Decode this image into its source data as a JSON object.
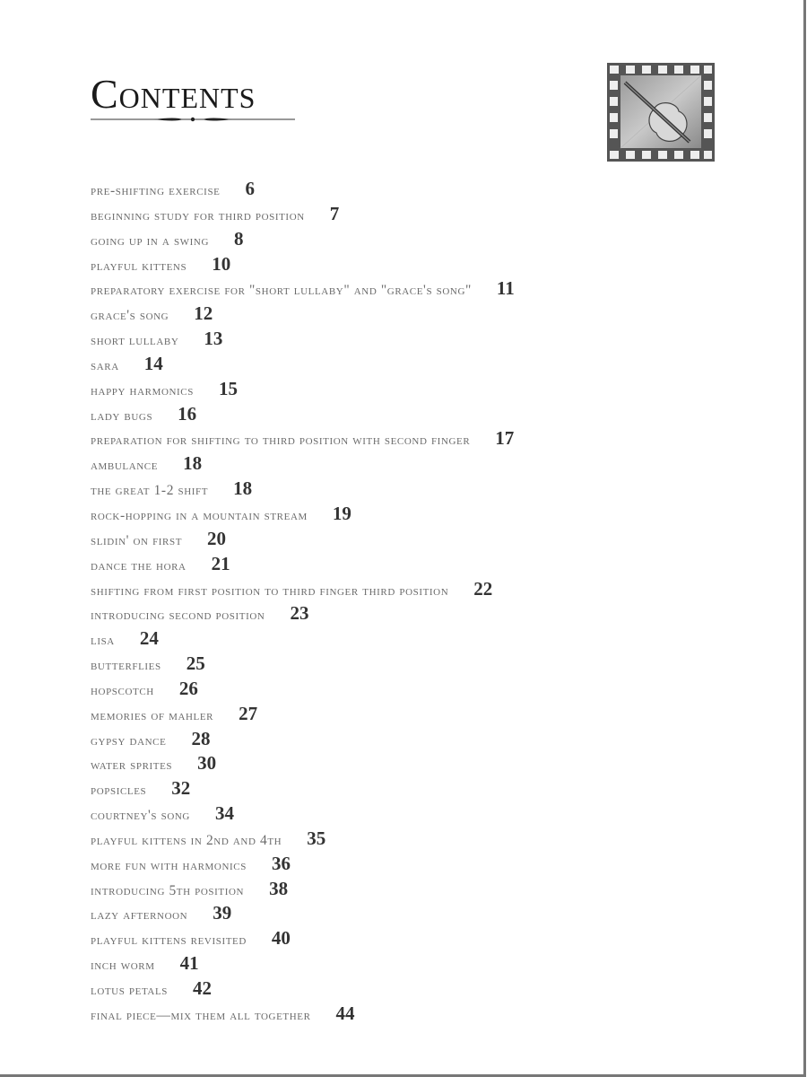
{
  "page": {
    "title": "Contents",
    "emblem_icon": "violin-tile-icon"
  },
  "toc": [
    {
      "title": "Pre-Shifting Exercise",
      "page": "6"
    },
    {
      "title": "Beginning Study for Third Position",
      "page": "7"
    },
    {
      "title": "Going Up in a Swing",
      "page": "8"
    },
    {
      "title": "Playful Kittens",
      "page": "10"
    },
    {
      "title": "Preparatory Exercise for \"Short Lullaby\" and \"Grace's Song\"",
      "page": "11"
    },
    {
      "title": "Grace's Song",
      "page": "12"
    },
    {
      "title": "Short Lullaby",
      "page": "13"
    },
    {
      "title": "Sara",
      "page": "14"
    },
    {
      "title": "Happy Harmonics",
      "page": "15"
    },
    {
      "title": "Lady Bugs",
      "page": "16"
    },
    {
      "title": "Preparation for Shifting to Third Position with Second Finger",
      "page": "17"
    },
    {
      "title": "Ambulance",
      "page": "18"
    },
    {
      "title": "The Great 1-2 Shift",
      "page": "18"
    },
    {
      "title": "Rock-Hopping in a Mountain Stream",
      "page": "19"
    },
    {
      "title": "Slidin' on First",
      "page": "20"
    },
    {
      "title": "Dance the Hora",
      "page": "21"
    },
    {
      "title": "Shifting from First Position to Third Finger Third Position",
      "page": "22"
    },
    {
      "title": "Introducing Second Position",
      "page": "23"
    },
    {
      "title": "Lisa",
      "page": "24"
    },
    {
      "title": "Butterflies",
      "page": "25"
    },
    {
      "title": "Hopscotch",
      "page": "26"
    },
    {
      "title": "Memories of Mahler",
      "page": "27"
    },
    {
      "title": "Gypsy Dance",
      "page": "28"
    },
    {
      "title": "Water Sprites",
      "page": "30"
    },
    {
      "title": "Popsicles",
      "page": "32"
    },
    {
      "title": "Courtney's Song",
      "page": "34"
    },
    {
      "title": "Playful Kittens in 2nd and 4th",
      "page": "35"
    },
    {
      "title": "More Fun with Harmonics",
      "page": "36"
    },
    {
      "title": "Introducing 5th Position",
      "page": "38"
    },
    {
      "title": "Lazy Afternoon",
      "page": "39"
    },
    {
      "title": "Playful Kittens Revisited",
      "page": "40"
    },
    {
      "title": "Inch Worm",
      "page": "41"
    },
    {
      "title": "Lotus Petals",
      "page": "42"
    },
    {
      "title": "Final Piece—Mix Them All Together",
      "page": "44"
    }
  ]
}
